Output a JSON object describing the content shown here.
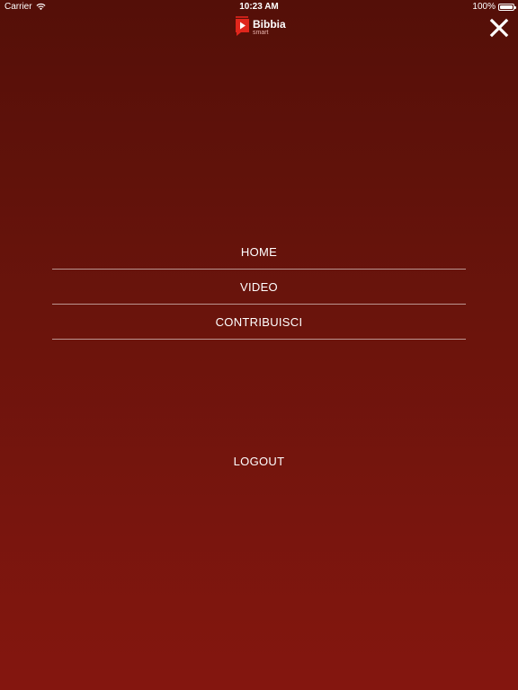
{
  "status_bar": {
    "carrier": "Carrier",
    "wifi_icon": "wifi-icon",
    "time": "10:23 AM",
    "battery_percent": "100%",
    "battery_level": 1.0,
    "battery_icon": "battery-icon"
  },
  "header": {
    "logo_main": "Bibbia",
    "logo_sub": "smart",
    "logo_icon": "bibbia-smart-logo-icon",
    "close_icon": "close-icon"
  },
  "menu": {
    "items": [
      {
        "label": "HOME"
      },
      {
        "label": "VIDEO"
      },
      {
        "label": "CONTRIBUISCI"
      }
    ],
    "logout_label": "LOGOUT"
  },
  "colors": {
    "background_top": "#540f08",
    "background_bottom": "#84160f",
    "logo_red": "#e0261c",
    "text": "#ffffff"
  }
}
